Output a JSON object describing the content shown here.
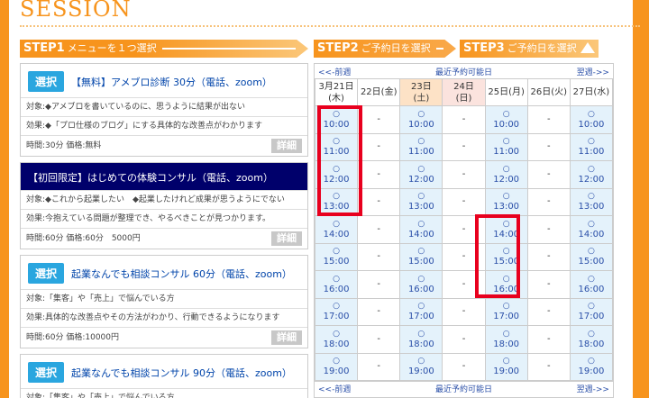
{
  "header": {
    "title": "SESSION"
  },
  "steps": [
    {
      "num": "STEP1",
      "label": "メニューを１つ選択"
    },
    {
      "num": "STEP2",
      "label": "ご予約日を選択"
    },
    {
      "num": "STEP3",
      "label": "ご予約日を選択"
    }
  ],
  "menus": [
    {
      "select": "選択",
      "title": "【無料】アメブロ診断 30分（電話、zoom）",
      "target": "対象:◆アメブロを書いているのに、思うように結果が出ない",
      "effect": "効果:◆「プロ仕様のブログ」にする具体的な改善点がわかります",
      "time": "時間:30分 価格:無料",
      "detail": "詳細"
    },
    {
      "select": "",
      "title": "【初回限定】はじめての体験コンサル（電話、zoom）",
      "target": "対象:◆これから起業したい　◆起業したけれど成果が思うようにでない",
      "effect": "効果:今抱えている問題が整理でき、やるべきことが見つかります。",
      "time": "時間:60分 価格:60分　5000円",
      "detail": "詳細"
    },
    {
      "select": "選択",
      "title": "起業なんでも相談コンサル 60分（電話、zoom）",
      "target": "対象:「集客」や「売上」で悩んでいる方",
      "effect": "効果:具体的な改善点やその方法がわかり、行動できるようになります",
      "time": "時間:60分 価格:10000円",
      "detail": "詳細"
    },
    {
      "select": "選択",
      "title": "起業なんでも相談コンサル 90分（電話、zoom）",
      "target": "対象:「集客」や「売上」で悩んでいる方",
      "effect": "",
      "time": "",
      "detail": ""
    }
  ],
  "calendar": {
    "prev": "<<-前週",
    "nearest": "最近予約可能日",
    "next": "翌週->>",
    "days": [
      {
        "date": "3月21日",
        "dow": "(木)",
        "type": "weekday",
        "open": true
      },
      {
        "date": "22日(金)",
        "dow": "",
        "type": "weekday",
        "open": false
      },
      {
        "date": "23日",
        "dow": "(土)",
        "type": "sat",
        "open": true
      },
      {
        "date": "24日",
        "dow": "(日)",
        "type": "sun",
        "open": false
      },
      {
        "date": "25日(月)",
        "dow": "",
        "type": "weekday",
        "open": true
      },
      {
        "date": "26日(火)",
        "dow": "",
        "type": "weekday",
        "open": false
      },
      {
        "date": "27日(水)",
        "dow": "",
        "type": "weekday",
        "open": true
      }
    ],
    "times": [
      "10:00",
      "11:00",
      "12:00",
      "13:00",
      "14:00",
      "15:00",
      "16:00",
      "17:00",
      "18:00",
      "19:00"
    ],
    "available_mark": "○",
    "unavailable_mark": "-",
    "highlight_color": "#e8001e"
  }
}
